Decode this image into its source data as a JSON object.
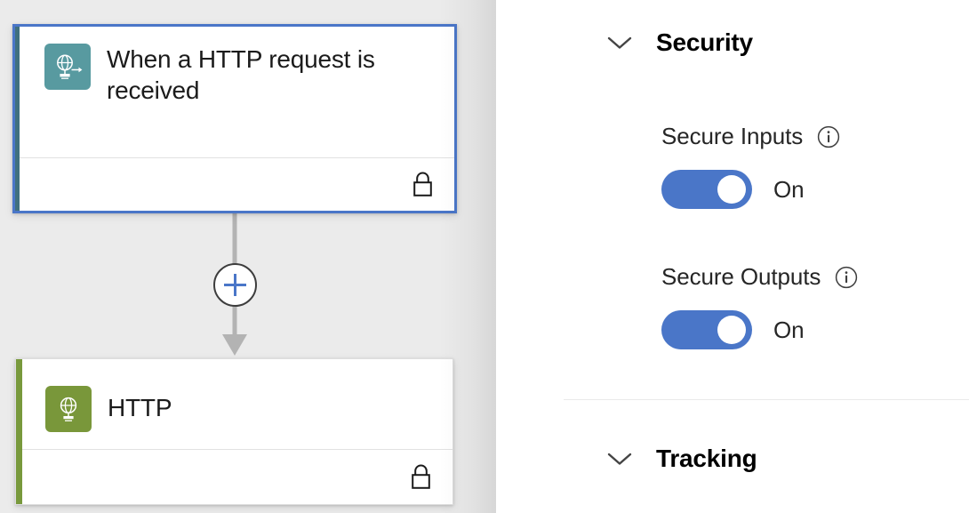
{
  "canvas": {
    "background_color": "#ebebeb",
    "nodes": [
      {
        "id": "trigger",
        "title": "When a HTTP request is received",
        "icon_name": "http-request-trigger-icon",
        "icon_color": "#589aa0",
        "accent_color": "#40707e",
        "selected": true,
        "selection_color": "#4a76c8",
        "footer_icon_name": "lock-icon"
      },
      {
        "id": "http-action",
        "title": "HTTP",
        "icon_name": "http-action-icon",
        "icon_color": "#79973a",
        "accent_color": "#78993c",
        "selected": false,
        "footer_icon_name": "lock-icon"
      }
    ],
    "connector": {
      "add_button_name": "add-step-button",
      "plus_color": "#4a76c8",
      "line_color": "#b3b3b3"
    }
  },
  "panel": {
    "sections": [
      {
        "id": "security",
        "title": "Security",
        "expanded": true,
        "chevron_icon": "chevron-down-icon"
      },
      {
        "id": "tracking",
        "title": "Tracking",
        "expanded": true,
        "chevron_icon": "chevron-down-icon"
      }
    ],
    "fields": [
      {
        "id": "secure-inputs",
        "label": "Secure Inputs",
        "info_icon": "info-icon",
        "toggle_state": "On",
        "toggle_on": true,
        "toggle_color": "#4a76c8"
      },
      {
        "id": "secure-outputs",
        "label": "Secure Outputs",
        "info_icon": "info-icon",
        "toggle_state": "On",
        "toggle_on": true,
        "toggle_color": "#4a76c8"
      }
    ]
  }
}
